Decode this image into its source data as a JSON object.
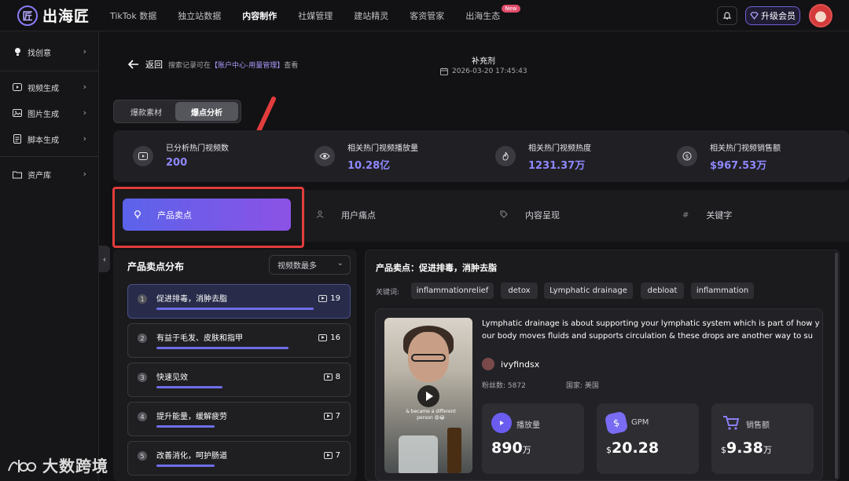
{
  "app": {
    "logo_mark": "匠",
    "logo_text": "出海匠"
  },
  "nav": {
    "items": [
      {
        "label": "TikTok 数据"
      },
      {
        "label": "独立站数据"
      },
      {
        "label": "内容制作"
      },
      {
        "label": "社媒管理"
      },
      {
        "label": "建站精灵"
      },
      {
        "label": "客资管家"
      },
      {
        "label": "出海生态"
      }
    ],
    "new_badge": "New",
    "upgrade_label": "升级会员"
  },
  "sidebar": {
    "items": [
      {
        "label": "找创意",
        "icon": "bulb-icon"
      },
      {
        "label": "视频生成",
        "icon": "video-icon"
      },
      {
        "label": "图片生成",
        "icon": "image-icon"
      },
      {
        "label": "脚本生成",
        "icon": "script-icon"
      },
      {
        "label": "资产库",
        "icon": "folder-icon"
      }
    ]
  },
  "header": {
    "back_label": "返回",
    "note_prefix": "搜索记录可在",
    "note_link": "【账户中心-用量管理】",
    "note_suffix": "查看",
    "title": "补充剂",
    "date": "2026-03-20 17:45:43"
  },
  "segment": {
    "options": [
      "爆款素材",
      "爆点分析"
    ],
    "selected": "爆点分析"
  },
  "stats": [
    {
      "label": "已分析热门视频数",
      "value": "200",
      "icon": "video-icon"
    },
    {
      "label": "相关热门视频播放量",
      "value": "10.28亿",
      "icon": "eye-icon"
    },
    {
      "label": "相关热门视频热度",
      "value": "1231.37万",
      "icon": "flame-icon"
    },
    {
      "label": "相关热门视频销售额",
      "value": "$967.53万",
      "icon": "dollar-icon"
    }
  ],
  "analysis_tabs": [
    {
      "label": "产品卖点",
      "icon": "bulb-icon"
    },
    {
      "label": "用户痛点",
      "icon": "user-icon"
    },
    {
      "label": "内容呈现",
      "icon": "tag-icon"
    },
    {
      "label": "关键字",
      "icon": "hash-icon"
    }
  ],
  "distribution": {
    "title": "产品卖点分布",
    "sort_label": "视频数最多",
    "items": [
      {
        "rank": "1",
        "label": "促进排毒，消肿去脂",
        "count": "19",
        "share": 1.0
      },
      {
        "rank": "2",
        "label": "有益于毛发、皮肤和指甲",
        "count": "16",
        "share": 0.84
      },
      {
        "rank": "3",
        "label": "快速见效",
        "count": "8",
        "share": 0.42
      },
      {
        "rank": "4",
        "label": "提升能量，缓解疲劳",
        "count": "7",
        "share": 0.37
      },
      {
        "rank": "5",
        "label": "改善消化，呵护肠道",
        "count": "7",
        "share": 0.37
      }
    ]
  },
  "detail": {
    "title": "产品卖点：促进排毒，消肿去脂",
    "keywords_label": "关键词:",
    "keywords": [
      "inflammationrelief",
      "detox",
      "Lymphatic drainage",
      "debloat",
      "inflammation"
    ],
    "video": {
      "caption": "& became a different person 😩😂",
      "description": "Lymphatic drainage is about supporting your lymphatic system which is part of how your body moves fluids and supports circulation & these drops are another way to su",
      "author": "ivyfindsx",
      "followers_label": "粉丝数: 5872",
      "country_label": "国家: 美国",
      "metrics": [
        {
          "label": "播放量",
          "prefix": "",
          "value": "890",
          "unit": "万",
          "icon": "play-icon",
          "color": "#6b5cf0"
        },
        {
          "label": "GPM",
          "prefix": "$",
          "value": "20.28",
          "unit": "",
          "icon": "dollar-icon",
          "color": "#7a6cf2"
        },
        {
          "label": "销售额",
          "prefix": "$",
          "value": "9.38",
          "unit": "万",
          "icon": "cart-icon",
          "color": "#8c7ef4"
        }
      ]
    }
  },
  "watermark": {
    "text": "大数跨境"
  }
}
